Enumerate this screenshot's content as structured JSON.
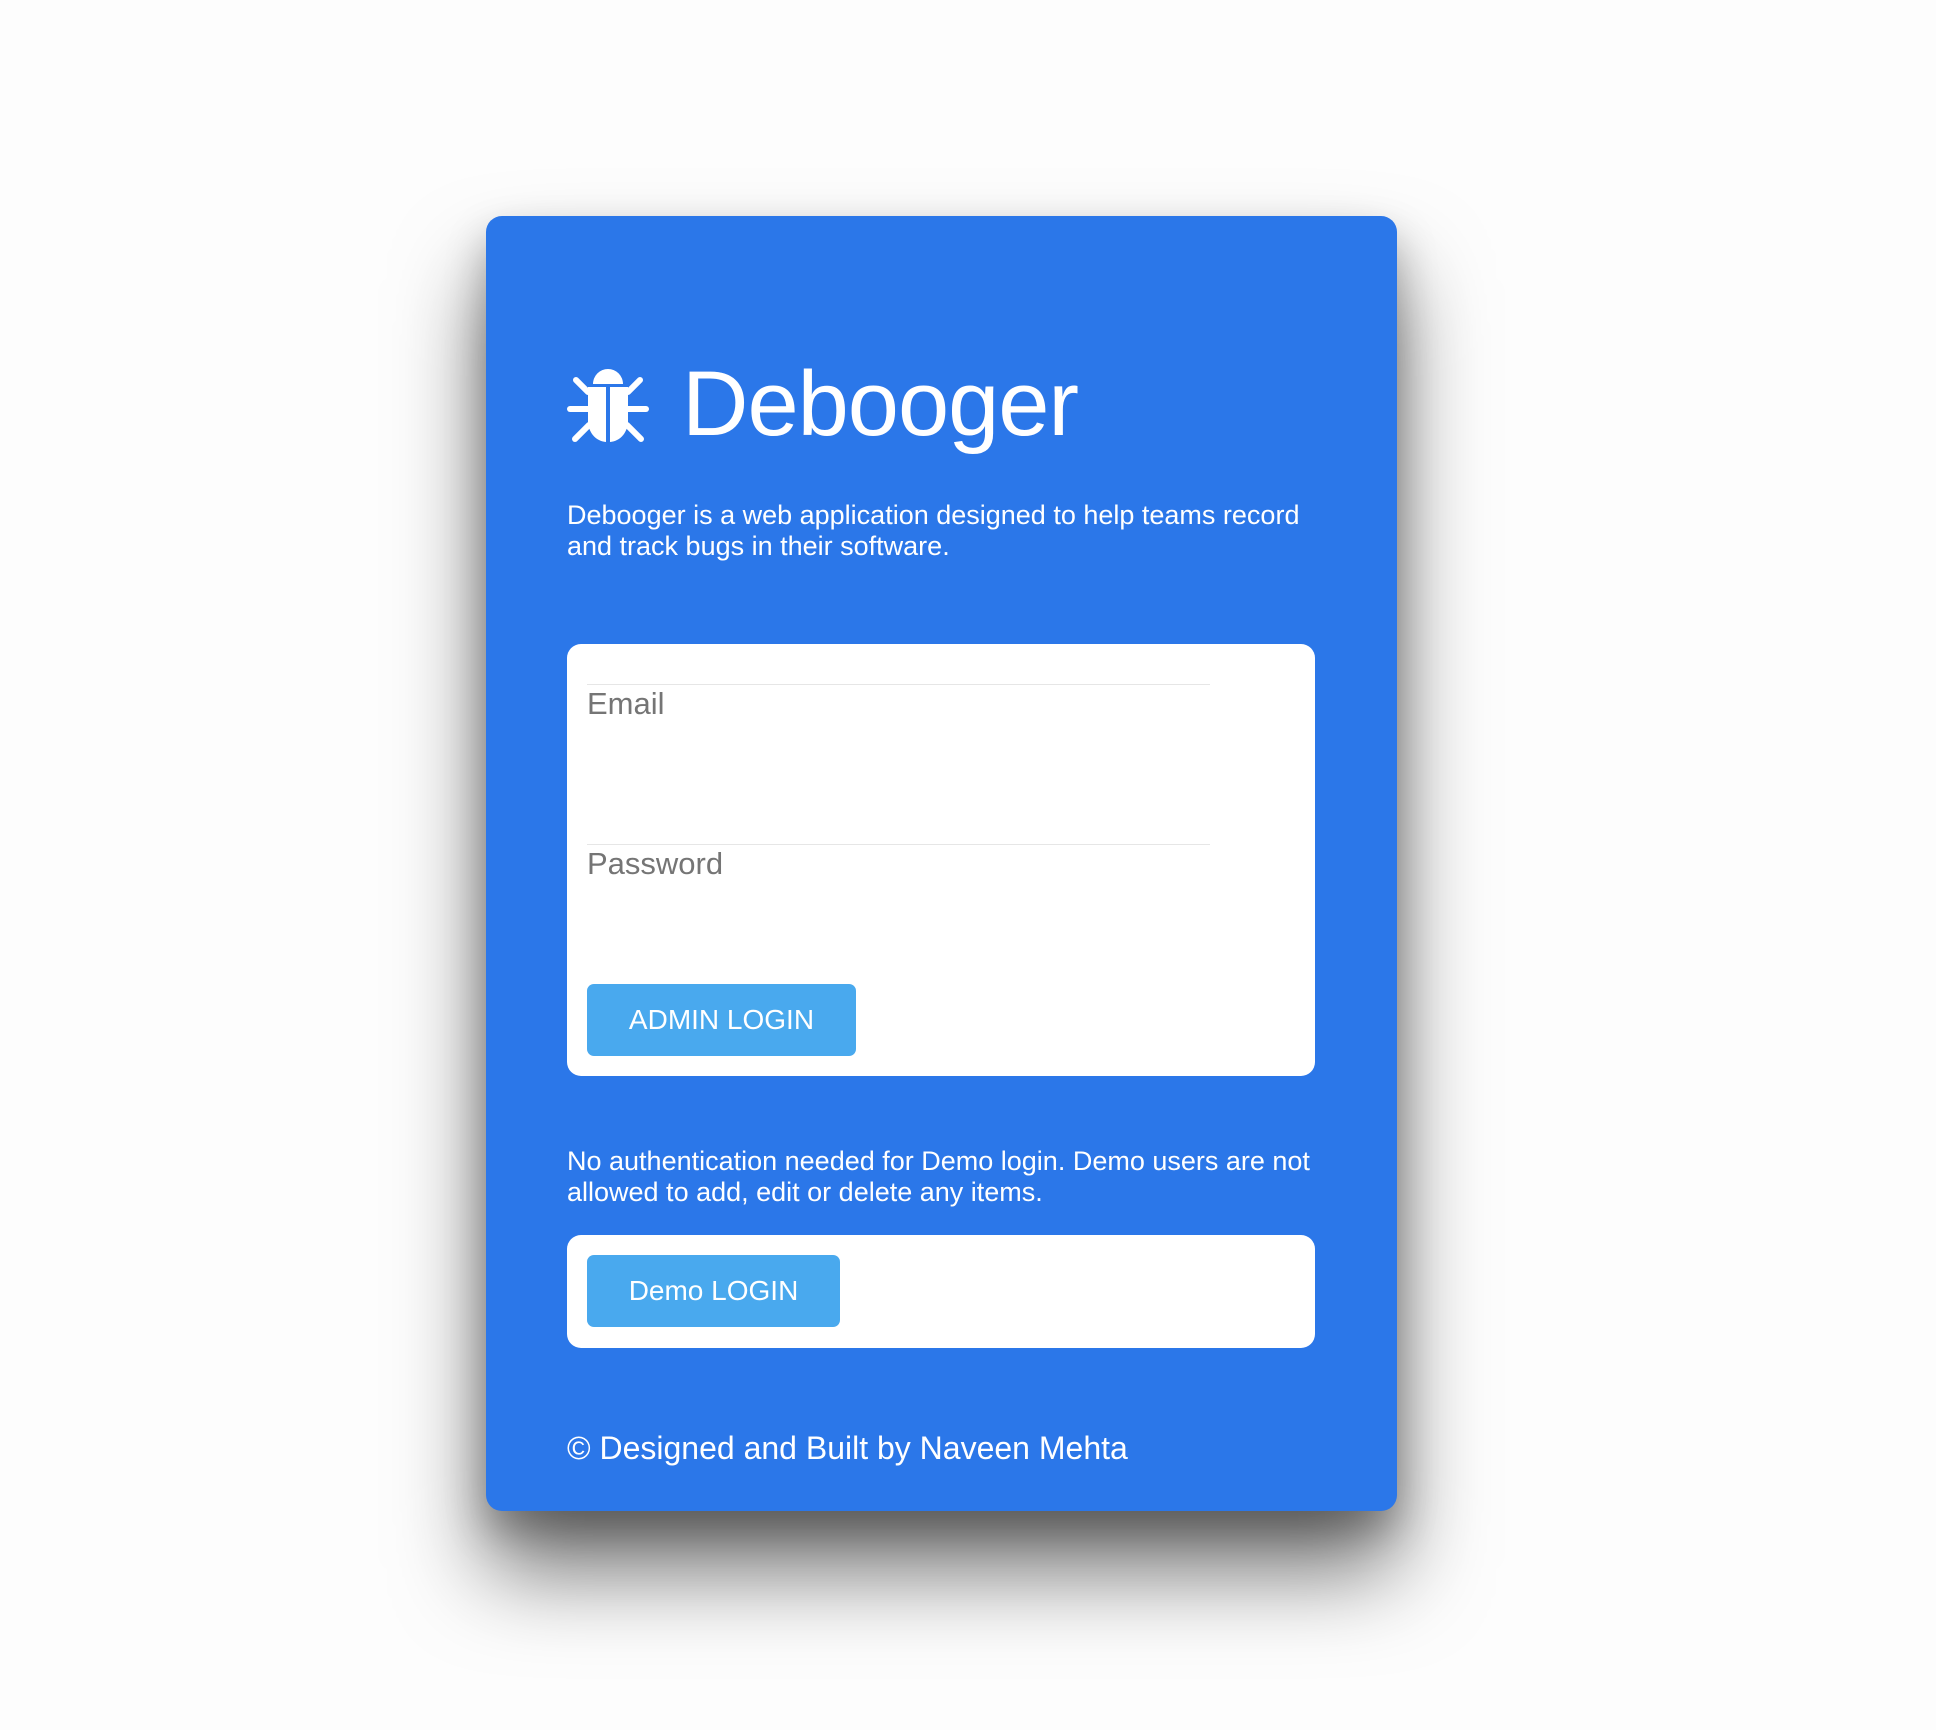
{
  "brand": {
    "icon": "bug-icon",
    "name": "Debooger"
  },
  "description": "Debooger is a web application designed to help teams record and track bugs in their software.",
  "login_form": {
    "email_label": "Email",
    "email_value": "",
    "password_label": "Password",
    "password_value": "",
    "admin_login_label": "ADMIN LOGIN"
  },
  "demo": {
    "note": "No authentication needed for Demo login. Demo users are not allowed to add, edit or delete any items.",
    "demo_login_label": "Demo LOGIN"
  },
  "footer": {
    "credit": "© Designed and Built by Naveen Mehta"
  },
  "colors": {
    "card_background": "#2b77e9",
    "button_background": "#49a9ee",
    "panel_background": "#ffffff",
    "text_on_card": "#ffffff",
    "label_gray": "#757575"
  }
}
